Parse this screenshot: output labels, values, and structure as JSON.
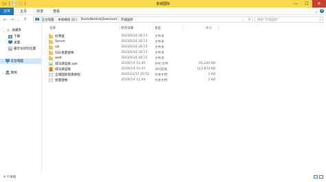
{
  "window": {
    "title": "京城国际",
    "minimize": "—",
    "maximize": "☐",
    "close": "✕"
  },
  "ribbon": {
    "tabs": [
      "文件",
      "主页",
      "共享",
      "查看"
    ],
    "expand": "⌄",
    "help": "?"
  },
  "nav": {
    "back": "←",
    "forward": "→",
    "recent": "⌄",
    "up": "↑",
    "breadcrumb": [
      "这台电脑",
      "本地磁盘 (D:)",
      "BaiduNetdiskDownload",
      "京城国际"
    ],
    "refresh": "↻",
    "search_placeholder": "搜索\"京城国际\""
  },
  "sidebar": {
    "items": [
      {
        "label": "收藏夹",
        "icon": "star-icon"
      },
      {
        "label": "下载",
        "icon": "download-folder-icon"
      },
      {
        "label": "桌面",
        "icon": "desktop-icon"
      },
      {
        "label": "最近访问的位置",
        "icon": "recent-places-icon"
      },
      {
        "label": "这台电脑",
        "icon": "computer-icon"
      },
      {
        "label": "网络",
        "icon": "network-icon"
      }
    ]
  },
  "columns": {
    "name": "名称",
    "modified": "修改日期",
    "type": "类型",
    "size": "大小"
  },
  "files": [
    {
      "name": "扒明盘",
      "modified": "2023/5/24 18:13",
      "type": "文件夹",
      "size": "",
      "icon": "folder-icon"
    },
    {
      "name": "Server",
      "modified": "2023/5/24 18:13",
      "type": "文件夹",
      "size": "",
      "icon": "folder-icon"
    },
    {
      "name": "sjk",
      "modified": "2023/5/24 18:13",
      "type": "文件夹",
      "size": "",
      "icon": "folder-icon"
    },
    {
      "name": "SQL批量替换",
      "modified": "2023/5/24 18:13",
      "type": "文件夹",
      "size": "",
      "icon": "folder-icon"
    },
    {
      "name": "web",
      "modified": "2023/5/24 18:13",
      "type": "文件夹",
      "size": "",
      "icon": "folder-icon"
    },
    {
      "name": "城马歌运板.apk",
      "modified": "2019/7/4 11:40",
      "type": "APK 文件",
      "size": "91,240 KB",
      "icon": "apk-file-icon"
    },
    {
      "name": "城马歌运板",
      "modified": "2019/7/4 15:47",
      "type": "360压缩",
      "size": "112,874 KB",
      "icon": "archive-file-icon"
    },
    {
      "name": "全城国际搭建教程",
      "modified": "2020/12/17 20:52",
      "type": "文本文档",
      "size": "1 KB",
      "icon": "text-file-icon"
    },
    {
      "name": "批量替换",
      "modified": "2019/7/4 11:44",
      "type": "文本文档",
      "size": "1 KB",
      "icon": "text-file-icon"
    }
  ],
  "status": {
    "count": "9 个项目"
  },
  "colors": {
    "titlebar": "#f7d94c",
    "file_tab": "#1979ca",
    "close_button": "#c8402e",
    "folder": "#f2c14e",
    "selection": "#cce8ff"
  }
}
